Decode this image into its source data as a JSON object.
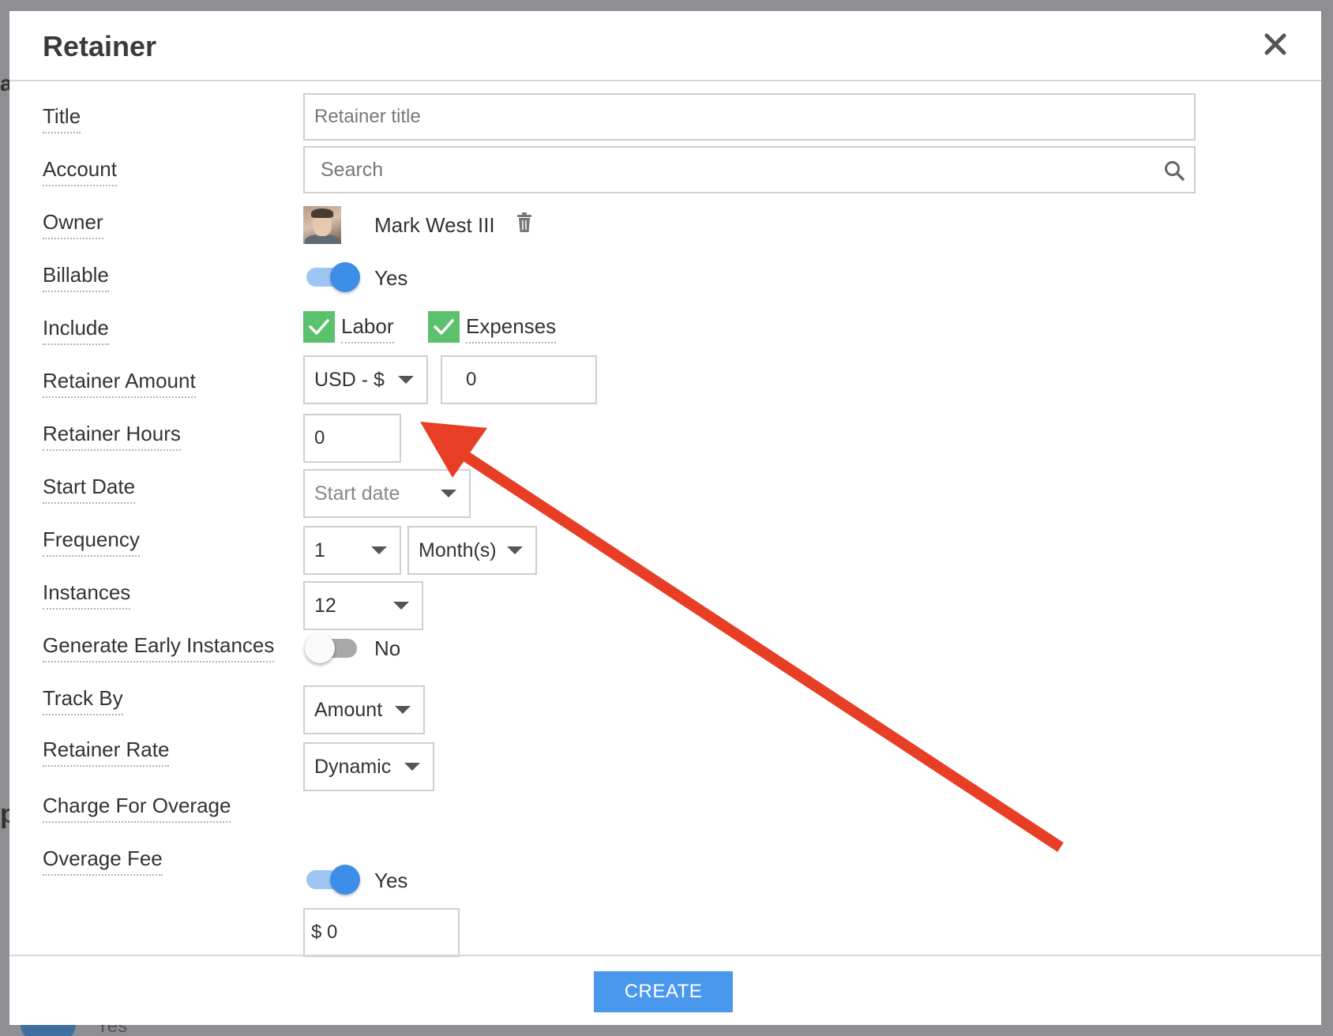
{
  "dialog": {
    "title": "Retainer",
    "close_icon": "close-icon"
  },
  "fields": {
    "title": {
      "label": "Title",
      "placeholder": "Retainer title"
    },
    "account": {
      "label": "Account",
      "placeholder": "Search",
      "icon": "search-icon"
    },
    "owner": {
      "label": "Owner",
      "name": "Mark West III",
      "icon": "trash-icon"
    },
    "billable": {
      "label": "Billable",
      "toggle_state": "on",
      "value_text": "Yes"
    },
    "include": {
      "label": "Include",
      "options": [
        {
          "label": "Labor",
          "checked": true
        },
        {
          "label": "Expenses",
          "checked": true
        }
      ]
    },
    "retainer_amount": {
      "label": "Retainer Amount",
      "currency": "USD - $",
      "amount": "0"
    },
    "retainer_hours": {
      "label": "Retainer Hours",
      "value": "0"
    },
    "start_date": {
      "label": "Start Date",
      "placeholder": "Start date"
    },
    "frequency": {
      "label": "Frequency",
      "count": "1",
      "unit": "Month(s)"
    },
    "instances": {
      "label": "Instances",
      "value": "12"
    },
    "generate_early_instances": {
      "label": "Generate Early Instances",
      "toggle_state": "off",
      "value_text": "No"
    },
    "track_by": {
      "label": "Track By",
      "value": "Amount"
    },
    "retainer_rate": {
      "label": "Retainer Rate",
      "value": "Dynamic"
    },
    "charge_for_overage": {
      "label": "Charge For Overage",
      "toggle_state": "on",
      "value_text": "Yes"
    },
    "overage_fee": {
      "label": "Overage Fee",
      "value": "$ 0"
    }
  },
  "footer": {
    "create_label": "CREATE"
  },
  "background": {
    "toggle_text": "Yes"
  },
  "colors": {
    "primary_button": "#4a98ee",
    "toggle_on": "#3d8ee6",
    "checkbox": "#5cc16d",
    "annotation_arrow": "#e83e26"
  }
}
